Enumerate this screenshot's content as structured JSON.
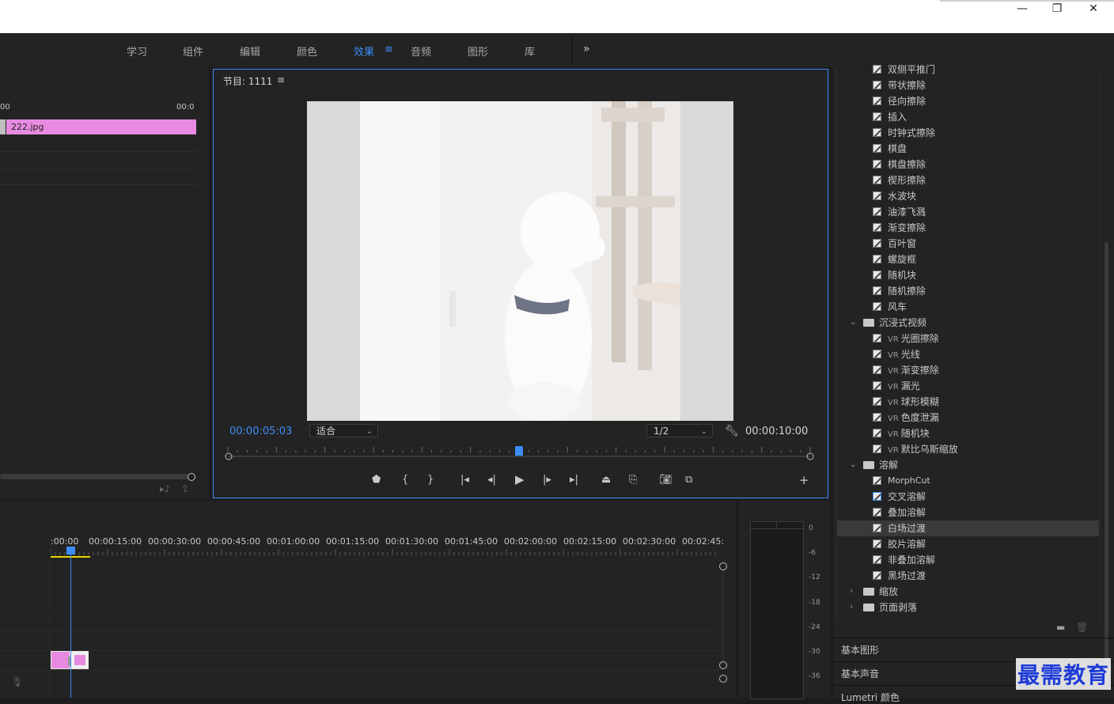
{
  "window": {
    "minimize_icon": "minimize-icon",
    "restore_icon": "restore-icon",
    "close_icon": "close-icon"
  },
  "workspaces": {
    "tabs": [
      {
        "label": "学习"
      },
      {
        "label": "组件"
      },
      {
        "label": "编辑"
      },
      {
        "label": "颜色"
      },
      {
        "label": "效果",
        "active": true
      },
      {
        "label": "音频"
      },
      {
        "label": "图形"
      },
      {
        "label": "库"
      }
    ],
    "more_label": "»",
    "active_color": "#3c8df6"
  },
  "source": {
    "ruler_left": "00",
    "ruler_right": "00:0",
    "clip_name": "222.jpg",
    "clip_color": "#e88be0"
  },
  "program": {
    "title": "节目: 1111",
    "menu": "≡",
    "current_time": "00:00:05:03",
    "zoom": "适合",
    "resolution": "1/2",
    "total_time": "00:00:10:00",
    "playhead_fraction": 0.5
  },
  "effects": {
    "items": [
      {
        "label": "双侧平推门",
        "partial": true
      },
      {
        "label": "带状擦除"
      },
      {
        "label": "径向擦除"
      },
      {
        "label": "插入"
      },
      {
        "label": "时钟式擦除"
      },
      {
        "label": "棋盘"
      },
      {
        "label": "棋盘擦除"
      },
      {
        "label": "楔形擦除"
      },
      {
        "label": "水波块"
      },
      {
        "label": "油漆飞溅"
      },
      {
        "label": "渐变擦除"
      },
      {
        "label": "百叶窗"
      },
      {
        "label": "螺旋框"
      },
      {
        "label": "随机块"
      },
      {
        "label": "随机擦除"
      },
      {
        "label": "风车"
      }
    ],
    "folder_immersive": "沉浸式视频",
    "vr_prefix": "VR",
    "vr_items": [
      {
        "label": "光圈擦除"
      },
      {
        "label": "光线"
      },
      {
        "label": "渐变擦除"
      },
      {
        "label": "漏光"
      },
      {
        "label": "球形模糊"
      },
      {
        "label": "色度泄漏"
      },
      {
        "label": "随机块"
      },
      {
        "label": "默比乌斯缩放"
      }
    ],
    "folder_dissolve": "溶解",
    "dissolve_items": [
      {
        "label": "MorphCut"
      },
      {
        "label": "交叉溶解"
      },
      {
        "label": "叠加溶解"
      },
      {
        "label": "白场过渡",
        "selected": true
      },
      {
        "label": "胶片溶解"
      },
      {
        "label": "非叠加溶解"
      },
      {
        "label": "黑场过渡"
      }
    ],
    "folder_scale": "缩放",
    "folder_page_peel": "页面剥落",
    "bottom_panels": [
      "基本图形",
      "基本声音",
      "Lumetri 颜色"
    ]
  },
  "timeline": {
    "times": [
      ":00:00",
      "00:00:15:00",
      "00:00:30:00",
      "00:00:45:00",
      "00:01:00:00",
      "00:01:15:00",
      "00:01:30:00",
      "00:01:45:00",
      "00:02:00:00",
      "00:02:15:00",
      "00:02:30:00",
      "00:02:45:"
    ],
    "clip_color": "#e88be0"
  },
  "meters": {
    "labels": [
      "0",
      "-6",
      "-12",
      "-18",
      "-24",
      "-30",
      "-36"
    ]
  },
  "watermark": "最需教育"
}
